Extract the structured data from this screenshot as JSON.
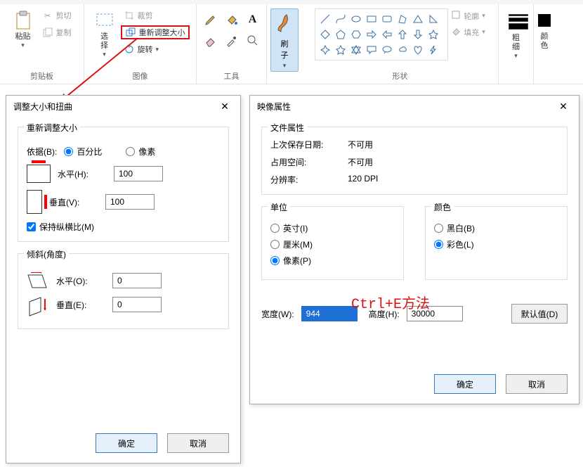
{
  "ribbon": {
    "clipboard": {
      "label": "剪贴板",
      "paste": "粘贴",
      "cut": "剪切",
      "copy": "复制"
    },
    "image": {
      "label": "图像",
      "select": "选\n择",
      "crop": "裁剪",
      "resize": "重新调整大小",
      "rotate": "旋转"
    },
    "tools": {
      "label": "工具"
    },
    "brush": "刷\n子",
    "shapes": {
      "label": "形状",
      "outline": "轮廓",
      "fill": "填充"
    },
    "thickness": "粗\n细",
    "color_label": "颜\n色"
  },
  "dlg1": {
    "title": "调整大小和扭曲",
    "resize_group": "重新调整大小",
    "by_label": "依据(B):",
    "by_percent": "百分比",
    "by_pixels": "像素",
    "horiz": "水平(H):",
    "vert": "垂直(V):",
    "h_value": "100",
    "v_value": "100",
    "keep_ar": "保持纵横比(M)",
    "skew_group": "倾斜(角度)",
    "skew_h": "水平(O):",
    "skew_v": "垂直(E):",
    "skew_h_val": "0",
    "skew_v_val": "0",
    "ok": "确定",
    "cancel": "取消"
  },
  "dlg2": {
    "title": "映像属性",
    "file_attr_group": "文件属性",
    "last_saved_k": "上次保存日期:",
    "last_saved_v": "不可用",
    "disk_k": "占用空间:",
    "disk_v": "不可用",
    "res_k": "分辨率:",
    "res_v": "120 DPI",
    "units_group": "单位",
    "inches": "英寸(I)",
    "cm": "厘米(M)",
    "pixels": "像素(P)",
    "colors_group": "颜色",
    "bw": "黑白(B)",
    "color": "彩色(L)",
    "width_k": "宽度(W):",
    "width_v": "944",
    "height_k": "高度(H):",
    "height_v": "30000",
    "default": "默认值(D)",
    "ok": "确定",
    "cancel": "取消"
  },
  "annot": "Ctrl+E方法"
}
